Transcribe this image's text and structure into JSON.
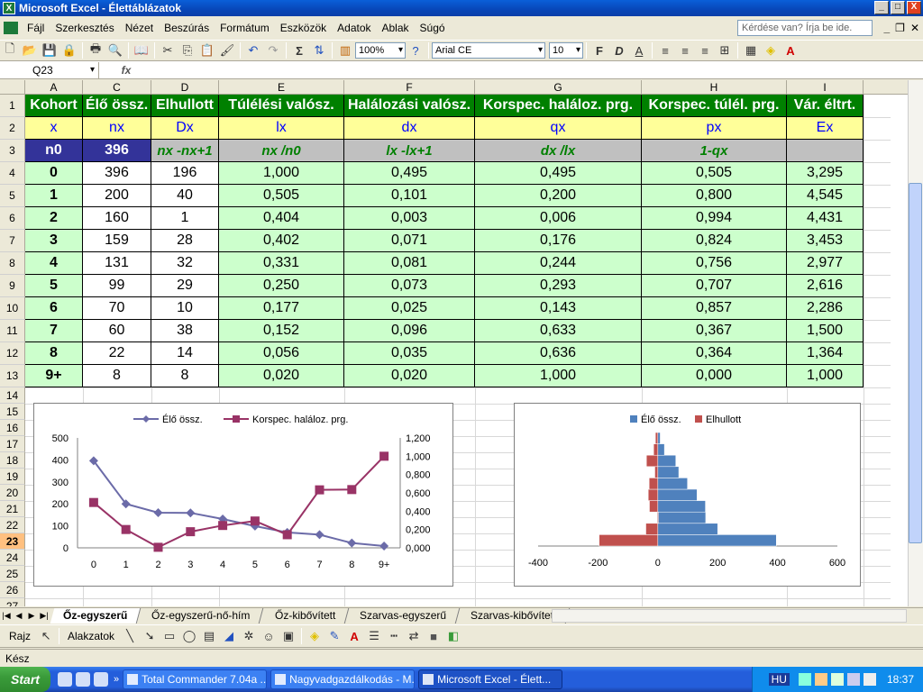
{
  "window": {
    "title": "Microsoft Excel - Élettáblázatok",
    "minimize": "_",
    "maximize": "□",
    "close": "X"
  },
  "menu": [
    "Fájl",
    "Szerkesztés",
    "Nézet",
    "Beszúrás",
    "Formátum",
    "Eszközök",
    "Adatok",
    "Ablak",
    "Súgó"
  ],
  "help_box": {
    "placeholder": "Kérdése van? Írja be ide."
  },
  "toolbar": {
    "zoom": "100%",
    "font": "Arial CE",
    "size": "10",
    "bold": "F",
    "italic": "D",
    "underline": "A"
  },
  "formula": {
    "name_box": "Q23",
    "fx": "fx"
  },
  "columns": [
    "A",
    "C",
    "D",
    "E",
    "F",
    "G",
    "H",
    "I"
  ],
  "rows": [
    "1",
    "2",
    "3",
    "4",
    "5",
    "6",
    "7",
    "8",
    "9",
    "10",
    "11",
    "12",
    "13",
    "14",
    "15",
    "16",
    "17",
    "18",
    "19",
    "20",
    "21",
    "22",
    "23",
    "24",
    "25",
    "26",
    "27"
  ],
  "table": {
    "headers": [
      "Kohort",
      "Élő össz.",
      "Elhullott",
      "Túlélési valósz.",
      "Halálozási valósz.",
      "Korspec. haláloz. prg.",
      "Korspec. túlél. prg.",
      "Vár. éltrt."
    ],
    "symbols": [
      "x",
      "nx",
      "Dx",
      "lx",
      "dx",
      "qx",
      "px",
      "Ex"
    ],
    "formulas": [
      "n0",
      "396",
      "nx -nx+1",
      "nx /n0",
      "lx -lx+1",
      "dx /lx",
      "1-qx",
      ""
    ],
    "data": [
      [
        "0",
        "396",
        "196",
        "1,000",
        "0,495",
        "0,495",
        "0,505",
        "3,295"
      ],
      [
        "1",
        "200",
        "40",
        "0,505",
        "0,101",
        "0,200",
        "0,800",
        "4,545"
      ],
      [
        "2",
        "160",
        "1",
        "0,404",
        "0,003",
        "0,006",
        "0,994",
        "4,431"
      ],
      [
        "3",
        "159",
        "28",
        "0,402",
        "0,071",
        "0,176",
        "0,824",
        "3,453"
      ],
      [
        "4",
        "131",
        "32",
        "0,331",
        "0,081",
        "0,244",
        "0,756",
        "2,977"
      ],
      [
        "5",
        "99",
        "29",
        "0,250",
        "0,073",
        "0,293",
        "0,707",
        "2,616"
      ],
      [
        "6",
        "70",
        "10",
        "0,177",
        "0,025",
        "0,143",
        "0,857",
        "2,286"
      ],
      [
        "7",
        "60",
        "38",
        "0,152",
        "0,096",
        "0,633",
        "0,367",
        "1,500"
      ],
      [
        "8",
        "22",
        "14",
        "0,056",
        "0,035",
        "0,636",
        "0,364",
        "1,364"
      ],
      [
        "9+",
        "8",
        "8",
        "0,020",
        "0,020",
        "1,000",
        "0,000",
        "1,000"
      ]
    ]
  },
  "chart_data": [
    {
      "type": "line",
      "categories": [
        "0",
        "1",
        "2",
        "3",
        "4",
        "5",
        "6",
        "7",
        "8",
        "9+"
      ],
      "series": [
        {
          "name": "Élő össz.",
          "axis": "left",
          "color": "#6b6ba8",
          "values": [
            396,
            200,
            160,
            159,
            131,
            99,
            70,
            60,
            22,
            8
          ]
        },
        {
          "name": "Korspec. haláloz. prg.",
          "axis": "right",
          "color": "#993366",
          "values": [
            0.495,
            0.2,
            0.006,
            0.176,
            0.244,
            0.293,
            0.143,
            0.633,
            0.636,
            1.0
          ]
        }
      ],
      "ylim_left": [
        0,
        500
      ],
      "yticks_left": [
        "0",
        "100",
        "200",
        "300",
        "400",
        "500"
      ],
      "ylim_right": [
        0,
        1.2
      ],
      "yticks_right": [
        "0,000",
        "0,200",
        "0,400",
        "0,600",
        "0,800",
        "1,000",
        "1,200"
      ],
      "legend": "top"
    },
    {
      "type": "bar",
      "orientation": "horizontal-pyramid",
      "series": [
        {
          "name": "Élő össz.",
          "color": "#4f81bd",
          "values": [
            396,
            200,
            160,
            159,
            131,
            99,
            70,
            60,
            22,
            8
          ]
        },
        {
          "name": "Elhullott",
          "color": "#c0504d",
          "values": [
            -196,
            -40,
            -1,
            -28,
            -32,
            -29,
            -10,
            -38,
            -14,
            -8
          ]
        }
      ],
      "xlim": [
        -400,
        600
      ],
      "xticks": [
        "-400",
        "-200",
        "0",
        "200",
        "400",
        "600"
      ],
      "legend": "top"
    }
  ],
  "sheets": [
    "Őz-egyszerű",
    "Őz-egyszerű-nő-hím",
    "Őz-kibővített",
    "Szarvas-egyszerű",
    "Szarvas-kibővített"
  ],
  "drawbar": {
    "draw": "Rajz",
    "shapes": "Alakzatok"
  },
  "status": "Kész",
  "taskbar": {
    "start": "Start",
    "tasks": [
      "Total Commander 7.04a ...",
      "Nagyvadgazdálkodás - M...",
      "Microsoft Excel - Élett..."
    ],
    "clock": "18:37",
    "lang": "HU"
  }
}
